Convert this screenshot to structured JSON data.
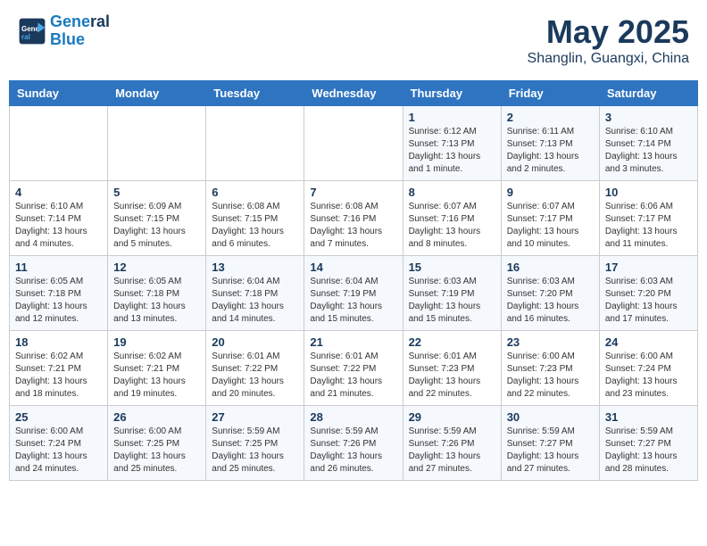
{
  "header": {
    "logo_line1": "General",
    "logo_line2": "Blue",
    "month": "May 2025",
    "location": "Shanglin, Guangxi, China"
  },
  "weekdays": [
    "Sunday",
    "Monday",
    "Tuesday",
    "Wednesday",
    "Thursday",
    "Friday",
    "Saturday"
  ],
  "weeks": [
    [
      {
        "day": "",
        "text": ""
      },
      {
        "day": "",
        "text": ""
      },
      {
        "day": "",
        "text": ""
      },
      {
        "day": "",
        "text": ""
      },
      {
        "day": "1",
        "text": "Sunrise: 6:12 AM\nSunset: 7:13 PM\nDaylight: 13 hours and 1 minute."
      },
      {
        "day": "2",
        "text": "Sunrise: 6:11 AM\nSunset: 7:13 PM\nDaylight: 13 hours and 2 minutes."
      },
      {
        "day": "3",
        "text": "Sunrise: 6:10 AM\nSunset: 7:14 PM\nDaylight: 13 hours and 3 minutes."
      }
    ],
    [
      {
        "day": "4",
        "text": "Sunrise: 6:10 AM\nSunset: 7:14 PM\nDaylight: 13 hours and 4 minutes."
      },
      {
        "day": "5",
        "text": "Sunrise: 6:09 AM\nSunset: 7:15 PM\nDaylight: 13 hours and 5 minutes."
      },
      {
        "day": "6",
        "text": "Sunrise: 6:08 AM\nSunset: 7:15 PM\nDaylight: 13 hours and 6 minutes."
      },
      {
        "day": "7",
        "text": "Sunrise: 6:08 AM\nSunset: 7:16 PM\nDaylight: 13 hours and 7 minutes."
      },
      {
        "day": "8",
        "text": "Sunrise: 6:07 AM\nSunset: 7:16 PM\nDaylight: 13 hours and 8 minutes."
      },
      {
        "day": "9",
        "text": "Sunrise: 6:07 AM\nSunset: 7:17 PM\nDaylight: 13 hours and 10 minutes."
      },
      {
        "day": "10",
        "text": "Sunrise: 6:06 AM\nSunset: 7:17 PM\nDaylight: 13 hours and 11 minutes."
      }
    ],
    [
      {
        "day": "11",
        "text": "Sunrise: 6:05 AM\nSunset: 7:18 PM\nDaylight: 13 hours and 12 minutes."
      },
      {
        "day": "12",
        "text": "Sunrise: 6:05 AM\nSunset: 7:18 PM\nDaylight: 13 hours and 13 minutes."
      },
      {
        "day": "13",
        "text": "Sunrise: 6:04 AM\nSunset: 7:18 PM\nDaylight: 13 hours and 14 minutes."
      },
      {
        "day": "14",
        "text": "Sunrise: 6:04 AM\nSunset: 7:19 PM\nDaylight: 13 hours and 15 minutes."
      },
      {
        "day": "15",
        "text": "Sunrise: 6:03 AM\nSunset: 7:19 PM\nDaylight: 13 hours and 15 minutes."
      },
      {
        "day": "16",
        "text": "Sunrise: 6:03 AM\nSunset: 7:20 PM\nDaylight: 13 hours and 16 minutes."
      },
      {
        "day": "17",
        "text": "Sunrise: 6:03 AM\nSunset: 7:20 PM\nDaylight: 13 hours and 17 minutes."
      }
    ],
    [
      {
        "day": "18",
        "text": "Sunrise: 6:02 AM\nSunset: 7:21 PM\nDaylight: 13 hours and 18 minutes."
      },
      {
        "day": "19",
        "text": "Sunrise: 6:02 AM\nSunset: 7:21 PM\nDaylight: 13 hours and 19 minutes."
      },
      {
        "day": "20",
        "text": "Sunrise: 6:01 AM\nSunset: 7:22 PM\nDaylight: 13 hours and 20 minutes."
      },
      {
        "day": "21",
        "text": "Sunrise: 6:01 AM\nSunset: 7:22 PM\nDaylight: 13 hours and 21 minutes."
      },
      {
        "day": "22",
        "text": "Sunrise: 6:01 AM\nSunset: 7:23 PM\nDaylight: 13 hours and 22 minutes."
      },
      {
        "day": "23",
        "text": "Sunrise: 6:00 AM\nSunset: 7:23 PM\nDaylight: 13 hours and 22 minutes."
      },
      {
        "day": "24",
        "text": "Sunrise: 6:00 AM\nSunset: 7:24 PM\nDaylight: 13 hours and 23 minutes."
      }
    ],
    [
      {
        "day": "25",
        "text": "Sunrise: 6:00 AM\nSunset: 7:24 PM\nDaylight: 13 hours and 24 minutes."
      },
      {
        "day": "26",
        "text": "Sunrise: 6:00 AM\nSunset: 7:25 PM\nDaylight: 13 hours and 25 minutes."
      },
      {
        "day": "27",
        "text": "Sunrise: 5:59 AM\nSunset: 7:25 PM\nDaylight: 13 hours and 25 minutes."
      },
      {
        "day": "28",
        "text": "Sunrise: 5:59 AM\nSunset: 7:26 PM\nDaylight: 13 hours and 26 minutes."
      },
      {
        "day": "29",
        "text": "Sunrise: 5:59 AM\nSunset: 7:26 PM\nDaylight: 13 hours and 27 minutes."
      },
      {
        "day": "30",
        "text": "Sunrise: 5:59 AM\nSunset: 7:27 PM\nDaylight: 13 hours and 27 minutes."
      },
      {
        "day": "31",
        "text": "Sunrise: 5:59 AM\nSunset: 7:27 PM\nDaylight: 13 hours and 28 minutes."
      }
    ]
  ]
}
